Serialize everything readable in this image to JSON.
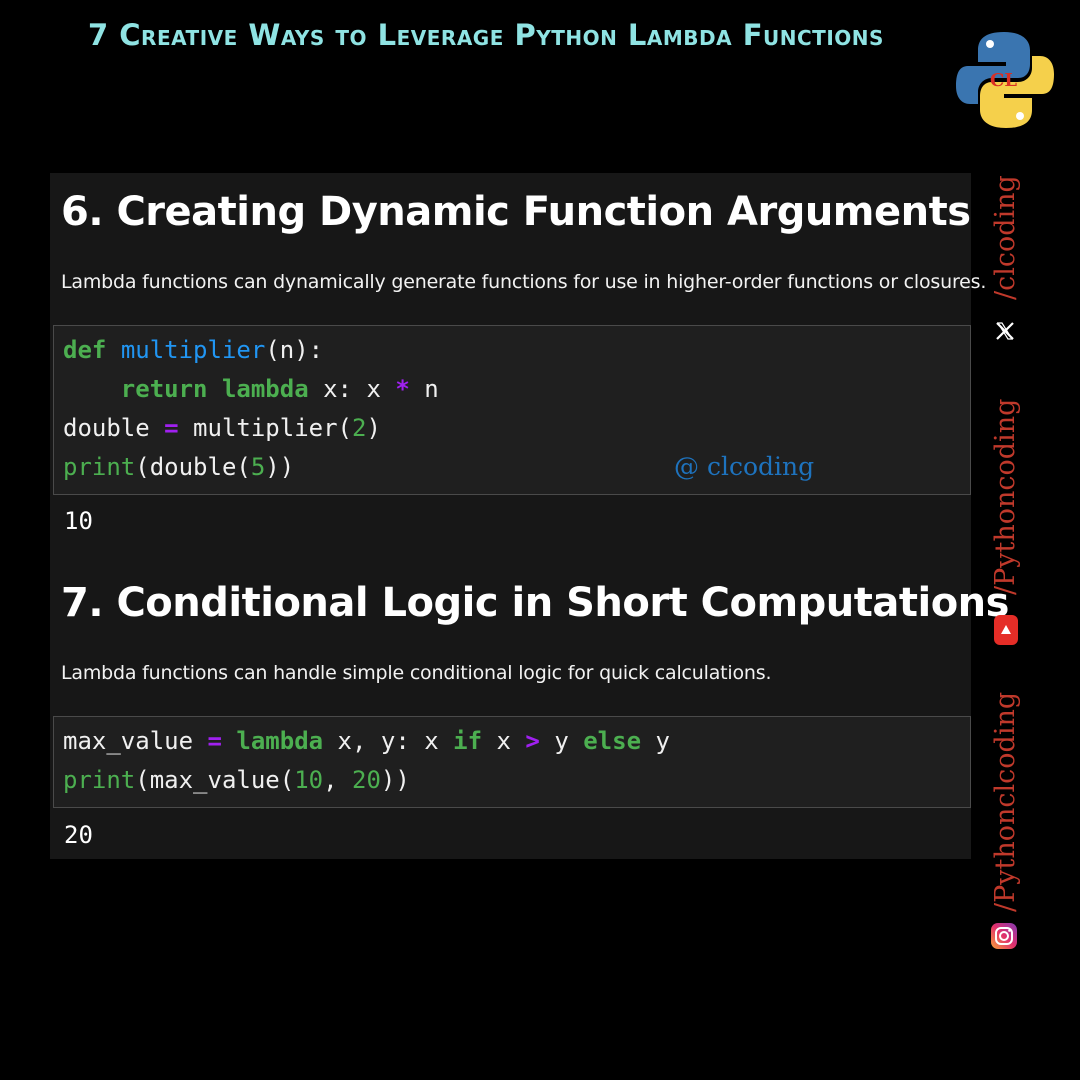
{
  "banner": {
    "title": "7 Creative Ways to Leverage Python Lambda Functions"
  },
  "colors": {
    "banner": "#8fe3e3",
    "keyword": "#4caf50",
    "function": "#2196f3",
    "operator": "#a020f0",
    "handle": "#c0392b"
  },
  "sections": [
    {
      "title": "6. Creating Dynamic Function Arguments",
      "description": "Lambda functions can dynamically generate functions for use in higher-order functions or closures.",
      "code": {
        "l1": {
          "kw": "def",
          "name": "multiplier",
          "rest": "(n):"
        },
        "l2": {
          "indent": "    ",
          "kw1": "return",
          "kw2": "lambda",
          "mid": " x: x ",
          "op": "*",
          "end": " n"
        },
        "l3": {
          "var": "double ",
          "op": "=",
          "call": " multiplier(",
          "num": "2",
          "end": ")"
        },
        "l4": {
          "builtin": "print",
          "open": "(double(",
          "num": "5",
          "end": "))"
        }
      },
      "watermark": "@ clcoding",
      "output": "10"
    },
    {
      "title": "7. Conditional Logic in Short Computations",
      "description": "Lambda functions can handle simple conditional logic for quick calculations.",
      "code": {
        "l1": {
          "var": "max_value ",
          "op": "=",
          "kw": " lambda",
          "mid": " x, y: x ",
          "kw2": "if",
          "mid2": " x ",
          "op2": ">",
          "mid3": " y ",
          "kw3": "else",
          "end": " y"
        },
        "l2": {
          "builtin": "print",
          "open": "(max_value(",
          "num1": "10",
          "comma": ", ",
          "num2": "20",
          "end": "))"
        }
      },
      "output": "20"
    }
  ],
  "social": {
    "twitter_handle": "/clcoding",
    "youtube_handle": "/Pythoncoding",
    "instagram_handle": "/Pythonclcoding",
    "icons": [
      "x-icon",
      "youtube-icon",
      "instagram-icon"
    ]
  },
  "logo": {
    "letters": "CL"
  }
}
